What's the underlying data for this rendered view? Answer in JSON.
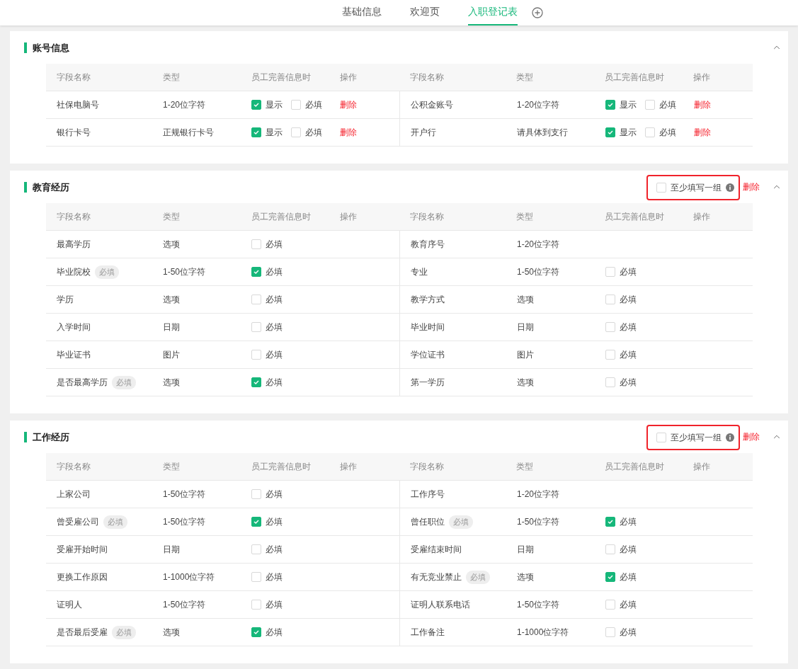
{
  "tabs": [
    {
      "label": "基础信息",
      "selected": false
    },
    {
      "label": "欢迎页",
      "selected": false
    },
    {
      "label": "入职登记表",
      "selected": true
    }
  ],
  "sections": [
    {
      "title": "账号信息",
      "expanded": true,
      "columns": [
        "字段名称",
        "类型",
        "员工完善信息时",
        "操作",
        "字段名称",
        "类型",
        "员工完善信息时",
        "操作"
      ],
      "fields": [
        {
          "name": "社保电脑号",
          "type": "1-20位字符",
          "options": [
            {
              "label": "显示",
              "checked": true
            },
            {
              "label": "必填",
              "checked": false
            }
          ],
          "action": "删除"
        },
        {
          "name": "公积金账号",
          "type": "1-20位字符",
          "options": [
            {
              "label": "显示",
              "checked": true
            },
            {
              "label": "必填",
              "checked": false
            }
          ],
          "action": "删除"
        },
        {
          "name": "银行卡号",
          "type": "正规银行卡号",
          "options": [
            {
              "label": "显示",
              "checked": true
            },
            {
              "label": "必填",
              "checked": false
            }
          ],
          "action": "删除"
        },
        {
          "name": "开户行",
          "type": "请具体到支行",
          "options": [
            {
              "label": "显示",
              "checked": true
            },
            {
              "label": "必填",
              "checked": false
            }
          ],
          "action": "删除"
        }
      ]
    },
    {
      "title": "教育经历",
      "expanded": true,
      "group_option": {
        "label": "至少填写一组",
        "checked": false
      },
      "delete_label": "删除",
      "columns": [
        "字段名称",
        "类型",
        "员工完善信息时",
        "操作",
        "字段名称",
        "类型",
        "员工完善信息时",
        "操作"
      ],
      "fields": [
        {
          "name": "最高学历",
          "type": "选项",
          "options": [
            {
              "label": "必填",
              "checked": false
            }
          ]
        },
        {
          "name": "教育序号",
          "type": "1-20位字符"
        },
        {
          "name": "毕业院校",
          "badge": "必填",
          "type": "1-50位字符",
          "options": [
            {
              "label": "必填",
              "checked": true
            }
          ]
        },
        {
          "name": "专业",
          "type": "1-50位字符",
          "options": [
            {
              "label": "必填",
              "checked": false
            }
          ]
        },
        {
          "name": "学历",
          "type": "选项",
          "options": [
            {
              "label": "必填",
              "checked": false
            }
          ]
        },
        {
          "name": "教学方式",
          "type": "选项",
          "options": [
            {
              "label": "必填",
              "checked": false
            }
          ]
        },
        {
          "name": "入学时间",
          "type": "日期",
          "options": [
            {
              "label": "必填",
              "checked": false
            }
          ]
        },
        {
          "name": "毕业时间",
          "type": "日期",
          "options": [
            {
              "label": "必填",
              "checked": false
            }
          ]
        },
        {
          "name": "毕业证书",
          "type": "图片",
          "options": [
            {
              "label": "必填",
              "checked": false
            }
          ]
        },
        {
          "name": "学位证书",
          "type": "图片",
          "options": [
            {
              "label": "必填",
              "checked": false
            }
          ]
        },
        {
          "name": "是否最高学历",
          "badge": "必填",
          "type": "选项",
          "options": [
            {
              "label": "必填",
              "checked": true
            }
          ]
        },
        {
          "name": "第一学历",
          "type": "选项",
          "options": [
            {
              "label": "必填",
              "checked": false
            }
          ]
        }
      ]
    },
    {
      "title": "工作经历",
      "expanded": true,
      "group_option": {
        "label": "至少填写一组",
        "checked": false
      },
      "delete_label": "删除",
      "columns": [
        "字段名称",
        "类型",
        "员工完善信息时",
        "操作",
        "字段名称",
        "类型",
        "员工完善信息时",
        "操作"
      ],
      "fields": [
        {
          "name": "上家公司",
          "type": "1-50位字符",
          "options": [
            {
              "label": "必填",
              "checked": false
            }
          ]
        },
        {
          "name": "工作序号",
          "type": "1-20位字符"
        },
        {
          "name": "曾受雇公司",
          "badge": "必填",
          "type": "1-50位字符",
          "options": [
            {
              "label": "必填",
              "checked": true
            }
          ]
        },
        {
          "name": "曾任职位",
          "badge": "必填",
          "type": "1-50位字符",
          "options": [
            {
              "label": "必填",
              "checked": true
            }
          ]
        },
        {
          "name": "受雇开始时间",
          "type": "日期",
          "options": [
            {
              "label": "必填",
              "checked": false
            }
          ]
        },
        {
          "name": "受雇结束时间",
          "type": "日期",
          "options": [
            {
              "label": "必填",
              "checked": false
            }
          ]
        },
        {
          "name": "更换工作原因",
          "type": "1-1000位字符",
          "options": [
            {
              "label": "必填",
              "checked": false
            }
          ]
        },
        {
          "name": "有无竞业禁止",
          "badge": "必填",
          "type": "选项",
          "options": [
            {
              "label": "必填",
              "checked": true
            }
          ]
        },
        {
          "name": "证明人",
          "type": "1-50位字符",
          "options": [
            {
              "label": "必填",
              "checked": false
            }
          ]
        },
        {
          "name": "证明人联系电话",
          "type": "1-50位字符",
          "options": [
            {
              "label": "必填",
              "checked": false
            }
          ]
        },
        {
          "name": "是否最后受雇",
          "badge": "必填",
          "type": "选项",
          "options": [
            {
              "label": "必填",
              "checked": true
            }
          ]
        },
        {
          "name": "工作备注",
          "type": "1-1000位字符",
          "options": [
            {
              "label": "必填",
              "checked": false
            }
          ]
        }
      ]
    }
  ]
}
